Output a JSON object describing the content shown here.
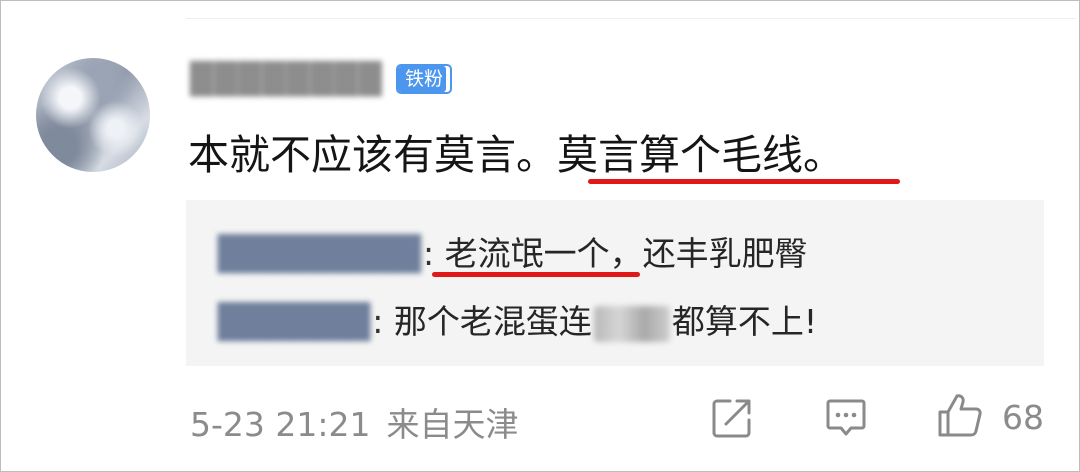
{
  "comment": {
    "username": "████████",
    "badge": "铁粉",
    "text_part1": "本就不应该有莫言。",
    "text_part2": "莫言算个毛线。"
  },
  "replies": [
    {
      "name": "████████",
      "colon": ":",
      "text_part1": "老流氓一个",
      "text_part2": "，还丰乳肥臀"
    },
    {
      "name": "██████",
      "colon": ":",
      "text_part1": "那个老混蛋连",
      "text_part2": "都算不上!"
    }
  ],
  "meta": {
    "time": "5-23 21:21",
    "location": "来自天津"
  },
  "actions": {
    "like_count": "68"
  },
  "colors": {
    "underline": "#e01818",
    "badge": "#4d96ee",
    "reply_bg": "#f4f4f4"
  },
  "icons": [
    "share-icon",
    "comment-icon",
    "like-icon"
  ]
}
